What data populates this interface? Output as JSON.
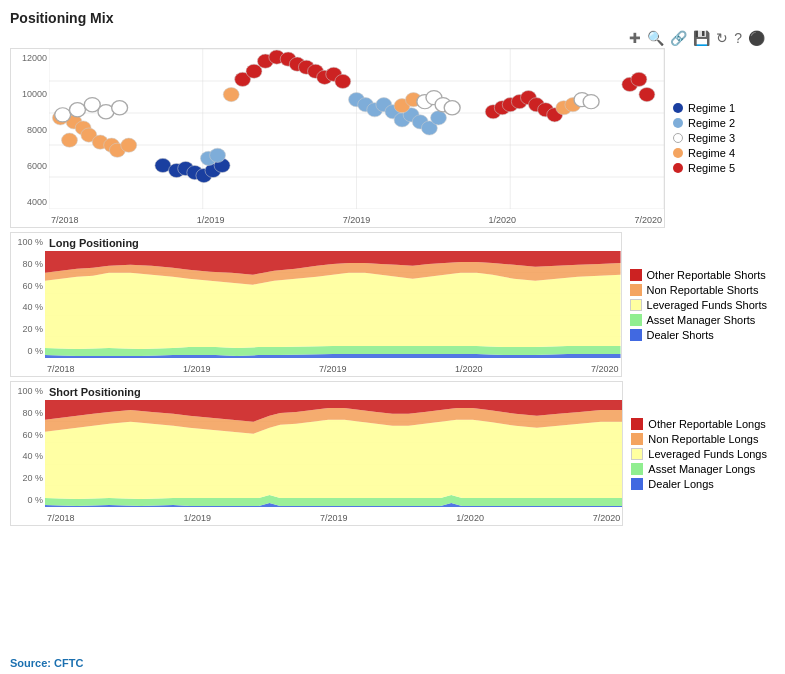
{
  "title": "Positioning Mix",
  "toolbar": {
    "icons": [
      "+",
      "🔍",
      "🔗",
      "💾",
      "↺",
      "?",
      "⚙"
    ]
  },
  "scatter": {
    "yAxis": [
      "12000",
      "10000",
      "8000",
      "6000",
      "4000"
    ],
    "xAxis": [
      "7/2018",
      "1/2019",
      "7/2019",
      "1/2020",
      "7/2020"
    ],
    "legend": [
      {
        "label": "Regime 1",
        "color": "#1a3fa0",
        "fill": true
      },
      {
        "label": "Regime 2",
        "color": "#7eadd9",
        "fill": true
      },
      {
        "label": "Regime 3",
        "color": "#ffffff",
        "fill": false
      },
      {
        "label": "Regime 4",
        "color": "#f4a460",
        "fill": true
      },
      {
        "label": "Regime 5",
        "color": "#cc2222",
        "fill": true
      }
    ]
  },
  "longPos": {
    "title": "Long Positioning",
    "yAxis": [
      "100 %",
      "80 %",
      "60 %",
      "40 %",
      "20 %",
      "0 %"
    ],
    "xAxis": [
      "7/2018",
      "1/2019",
      "7/2019",
      "1/2020",
      "7/2020"
    ],
    "legend": [
      {
        "label": "Other Reportable Shorts",
        "color": "#cc2222"
      },
      {
        "label": "Non Reportable Shorts",
        "color": "#f4a460"
      },
      {
        "label": "Leveraged Funds Shorts",
        "color": "#ffffa0"
      },
      {
        "label": "Asset Manager Shorts",
        "color": "#90ee90"
      },
      {
        "label": "Dealer Shorts",
        "color": "#4169e1"
      }
    ]
  },
  "shortPos": {
    "title": "Short Positioning",
    "yAxis": [
      "100 %",
      "80 %",
      "60 %",
      "40 %",
      "20 %",
      "0 %"
    ],
    "xAxis": [
      "7/2018",
      "1/2019",
      "7/2019",
      "1/2020",
      "7/2020"
    ],
    "legend": [
      {
        "label": "Other Reportable Longs",
        "color": "#cc2222"
      },
      {
        "label": "Non Reportable Longs",
        "color": "#f4a460"
      },
      {
        "label": "Leveraged Funds Longs",
        "color": "#ffffa0"
      },
      {
        "label": "Asset Manager Longs",
        "color": "#90ee90"
      },
      {
        "label": "Dealer Longs",
        "color": "#4169e1"
      }
    ]
  },
  "source": {
    "prefix": "Source: ",
    "name": "CFTC"
  }
}
